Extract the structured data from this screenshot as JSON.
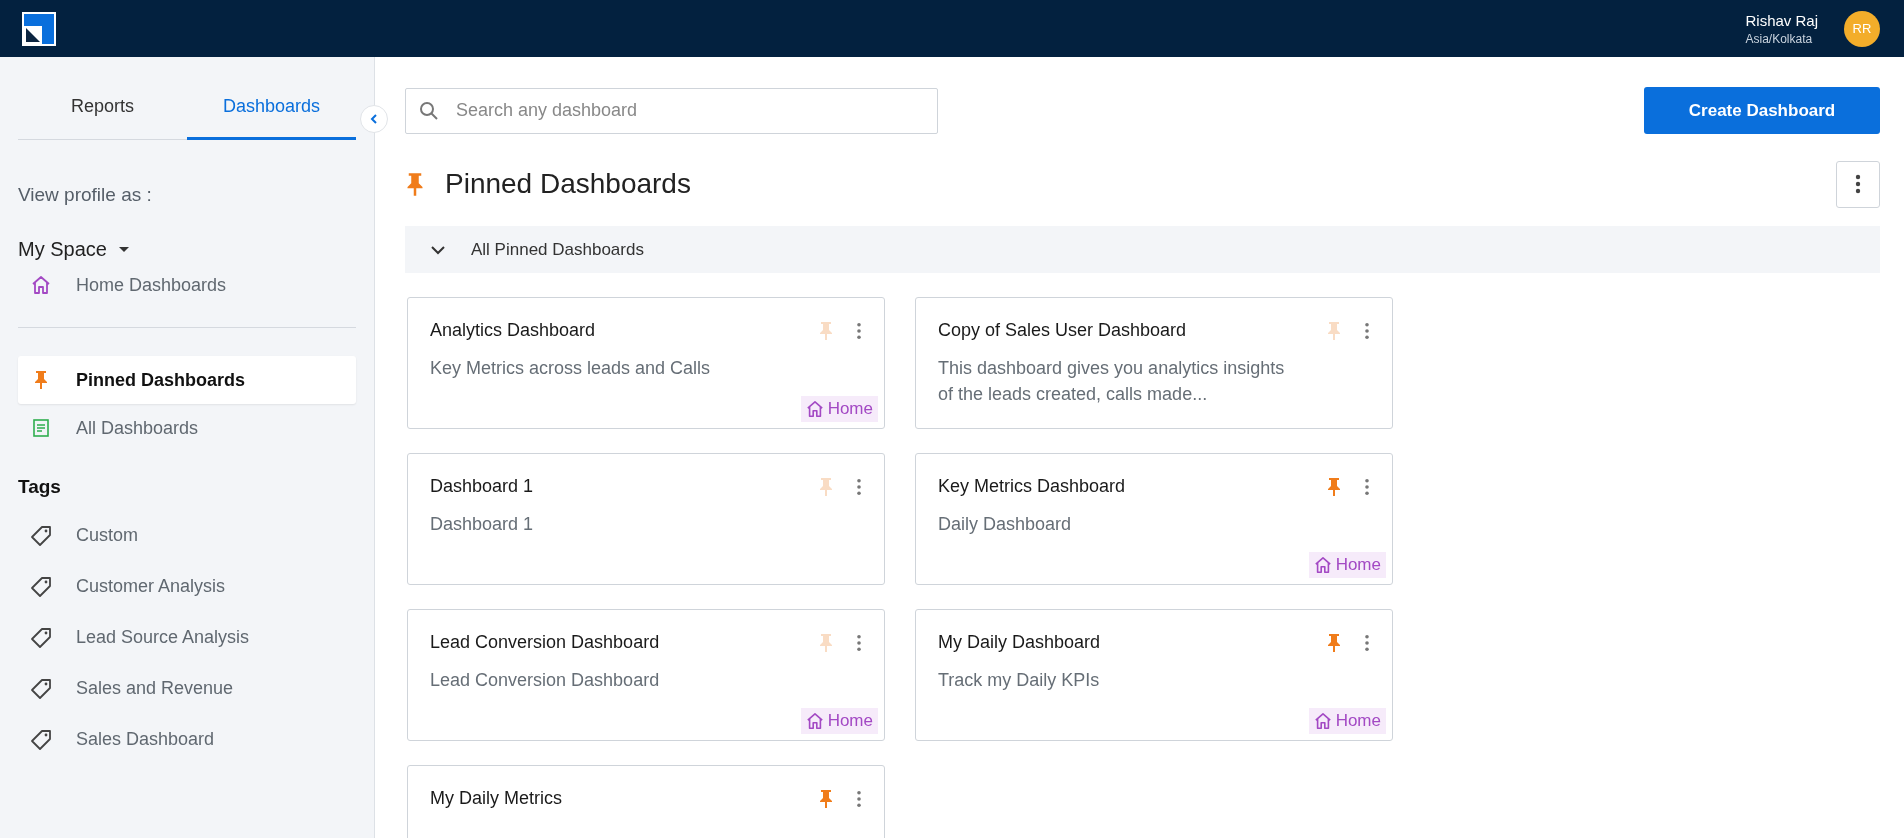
{
  "top_bar": {
    "user_name": "Rishav Raj",
    "timezone": "Asia/Kolkata",
    "avatar_initials": "RR"
  },
  "sidebar": {
    "tabs": [
      {
        "label": "Reports",
        "selected": false
      },
      {
        "label": "Dashboards",
        "selected": true
      }
    ],
    "view_profile_label": "View profile as :",
    "profile_select": "My Space",
    "home_item": {
      "label": "Home Dashboards"
    },
    "nav_items": [
      {
        "label": "Pinned Dashboards",
        "kind": "pinned",
        "selected": true
      },
      {
        "label": "All Dashboards",
        "kind": "all",
        "selected": false
      }
    ],
    "tags_heading": "Tags",
    "tags": [
      {
        "label": "Custom"
      },
      {
        "label": "Customer Analysis"
      },
      {
        "label": "Lead Source Analysis"
      },
      {
        "label": "Sales and Revenue"
      },
      {
        "label": "Sales Dashboard"
      }
    ]
  },
  "search": {
    "placeholder": "Search any dashboard"
  },
  "create_button": "Create Dashboard",
  "section_title": "Pinned Dashboards",
  "group": {
    "label": "All Pinned Dashboards",
    "expanded": true
  },
  "cards": [
    {
      "title": "Analytics Dashboard",
      "description": "Key Metrics across leads and Calls",
      "pinned": false,
      "tag": "Home"
    },
    {
      "title": "Copy of Sales User Dashboard",
      "description": "This dashboard gives you analytics insights of the leads created, calls made...",
      "pinned": false
    },
    {
      "title": "Dashboard 1",
      "description": "Dashboard 1",
      "pinned": false
    },
    {
      "title": "Key Metrics Dashboard",
      "description": "Daily Dashboard",
      "pinned": true,
      "tag": "Home"
    },
    {
      "title": "Lead Conversion Dashboard",
      "description": "Lead Conversion Dashboard",
      "pinned": false,
      "tag": "Home"
    },
    {
      "title": "My Daily Dashboard",
      "description": "Track my Daily KPIs",
      "pinned": true,
      "tag": "Home"
    },
    {
      "title": "My Daily Metrics",
      "pinned": true
    }
  ]
}
